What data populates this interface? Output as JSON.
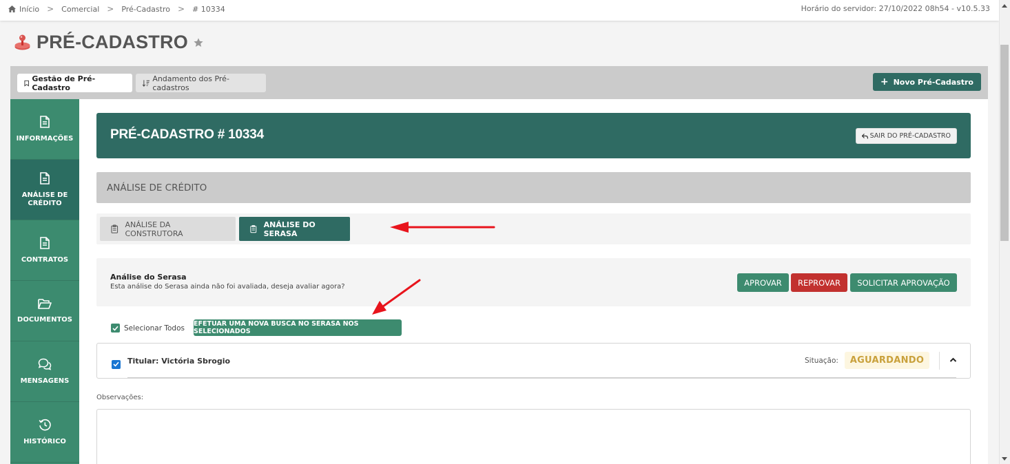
{
  "breadcrumb": {
    "items": [
      "Início",
      "Comercial",
      "Pré-Cadastro",
      "# 10334"
    ],
    "separator": ">"
  },
  "server_time": "Horário do servidor: 27/10/2022 08h54 - v10.5.33",
  "page": {
    "title": "PRÉ-CADASTRO",
    "title_icon": "joystick-icon",
    "favorite_icon": "star-icon"
  },
  "header_tabs": {
    "active": "Gestão de Pré-Cadastro",
    "inactive": "Andamento dos Pré-cadastros",
    "new_button": "Novo Pré-Cadastro"
  },
  "sidebar": {
    "items": [
      {
        "label": "INFORMAÇÕES",
        "icon": "document-icon",
        "active": false
      },
      {
        "label": "ANÁLISE DE CRÉDITO",
        "icon": "document-icon",
        "active": true
      },
      {
        "label": "CONTRATOS",
        "icon": "document-icon",
        "active": false
      },
      {
        "label": "DOCUMENTOS",
        "icon": "folder-open-icon",
        "active": false
      },
      {
        "label": "MENSAGENS",
        "icon": "chat-icon",
        "active": false
      },
      {
        "label": "HISTÓRICO",
        "icon": "history-icon",
        "active": false
      }
    ]
  },
  "main": {
    "title": "PRÉ-CADASTRO # 10334",
    "exit_button": "SAIR DO PRÉ-CADASTRO",
    "section_title": "ANÁLISE DE CRÉDITO",
    "subtabs": [
      {
        "label": "ANÁLISE DA CONSTRUTORA",
        "active": false
      },
      {
        "label": "ANÁLISE DO SERASA",
        "active": true
      }
    ]
  },
  "analysis": {
    "title": "Análise do Serasa",
    "description": "Esta análise do Serasa ainda não foi avaliada, deseja avaliar agora?",
    "approve": "APROVAR",
    "reject": "REPROVAR",
    "request": "SOLICITAR APROVAÇÃO"
  },
  "selection": {
    "select_all": "Selecionar Todos",
    "select_all_checked": true,
    "search_button": "EFETUAR UMA NOVA BUSCA NO SERASA NOS SELECIONADOS"
  },
  "holder": {
    "name": "Titular: Victória Sbrogio",
    "checked": true,
    "status_label": "Situação:",
    "status": "AGUARDANDO"
  },
  "observations": {
    "label": "Observações:",
    "value": ""
  },
  "colors": {
    "primary_dark": "#2f6b63",
    "primary": "#3d8b6f",
    "danger": "#c2312f",
    "warning_text": "#c9a13c",
    "annotation_arrow": "#e8141c"
  }
}
